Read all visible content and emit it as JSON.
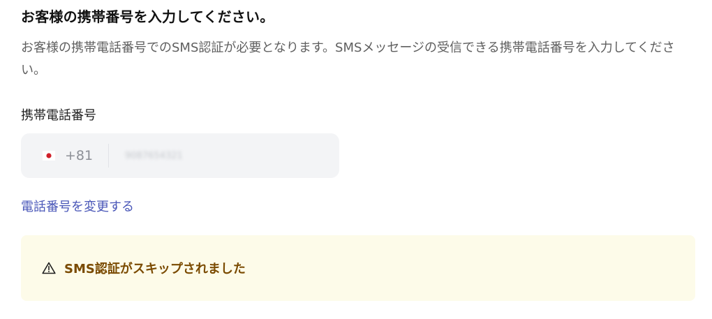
{
  "header": {
    "title": "お客様の携帯番号を入力してください。",
    "description": "お客様の携帯電話番号でのSMS認証が必要となります。SMSメッセージの受信できる携帯電話番号を入力してください。"
  },
  "phone_field": {
    "label": "携帯電話番号",
    "country_flag_icon": "japan-flag-icon",
    "dial_code": "+81",
    "value": "9087654321"
  },
  "change_link": {
    "label": "電話番号を変更する",
    "color": "#4a57b8"
  },
  "alert": {
    "icon": "warning-icon",
    "message": "SMS認証がスキップされました",
    "background": "#fdfbe9",
    "text_color": "#7a4a00"
  }
}
